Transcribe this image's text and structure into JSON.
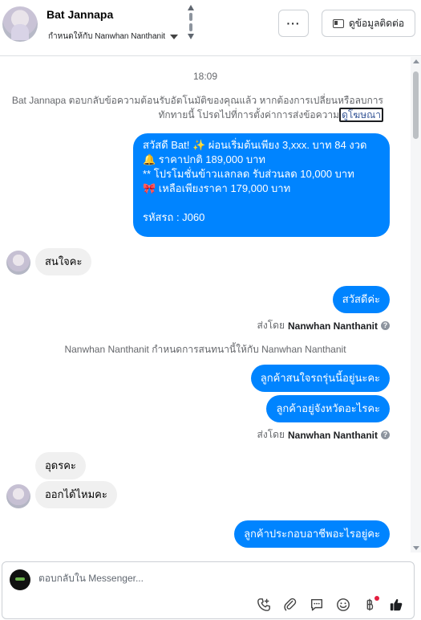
{
  "header": {
    "contact_name": "Bat Jannapa",
    "assigned_label": "กำหนดให้กับ Nanwhan Nanthanit",
    "more_label": "···",
    "contact_info_label": "ดูข้อมูลติดต่อ"
  },
  "chat": {
    "timestamp": "18:09",
    "auto_reply_notice": "Bat Jannapa ตอบกลับข้อความต้อนรับอัตโนมัติของคุณแล้ว หากต้องการเปลี่ยนหรือลบการทักทายนี้ โปรดไปที่การตั้งค่าการส่งข้อความ",
    "auto_reply_link": "ดูโฆษณา",
    "promo_message": "สวัสดี Bat! ✨  ผ่อนเริ่มต้นเพียง 3,xxx. บาท 84 งวด\n🔔 ราคาปกติ 189,000 บาท\n** โปรโมชั่นข้าวแลกลด รับส่วนลด 10,000 บาท\n🎀  เหลือเพียงราคา 179,000 บาท\n\nรหัสรถ : J060",
    "in_msg_1": "สนใจคะ",
    "out_msg_1": "สวัสดีค่ะ",
    "sent_by_prefix": "ส่งโดย",
    "sent_by_name": "Nanwhan Nanthanit",
    "assign_notice": "Nanwhan Nanthanit กำหนดการสนทนานี้ให้กับ Nanwhan Nanthanit",
    "out_msg_2": "ลูกค้าสนใจรถรุ่นนี้อยู่นะคะ",
    "out_msg_3": "ลูกค้าอยู่จังหวัดอะไรคะ",
    "in_msg_2": "อุดรคะ",
    "in_msg_3": "ออกได้ไหมคะ",
    "out_msg_4": "ลูกค้าประกอบอาชีพอะไรอยู่คะ"
  },
  "composer": {
    "placeholder": "ตอบกลับใน Messenger..."
  },
  "colors": {
    "outgoing_bubble": "#0084ff",
    "incoming_bubble": "#f0f0f0",
    "like_icon": "#1c1e21",
    "notification_dot": "#e41e3f"
  },
  "icons": [
    "phone-add-icon",
    "attachment-icon",
    "saved-reply-icon",
    "emoji-icon",
    "baht-payment-icon",
    "thumbs-up-icon"
  ]
}
